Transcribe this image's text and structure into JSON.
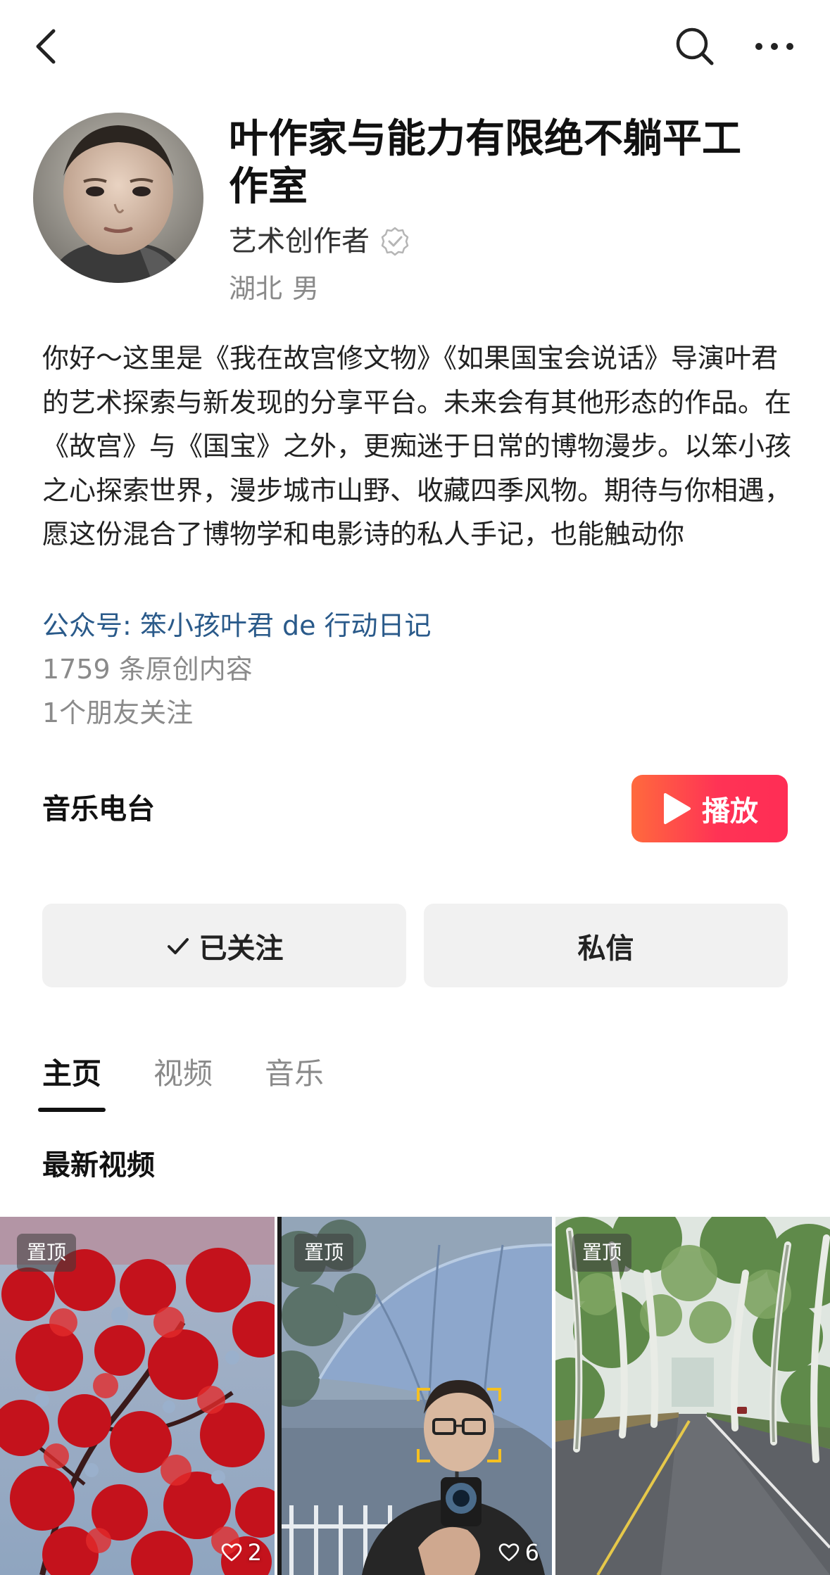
{
  "header": {
    "back_icon": "chevron-left-icon",
    "search_icon": "search-icon",
    "more_icon": "more-dots-icon"
  },
  "profile": {
    "name": "叶作家与能力有限绝不躺平工作室",
    "role": "艺术创作者",
    "verified_icon": "verified-badge-icon",
    "region": "湖北",
    "gender": "男"
  },
  "bio": "你好～这里是《我在故宫修文物》《如果国宝会说话》导演叶君的艺术探索与新发现的分享平台。未来会有其他形态的作品。在《故宫》与《国宝》之外，更痴迷于日常的博物漫步。以笨小孩之心探索世界，漫步城市山野、收藏四季风物。期待与你相遇，愿这份混合了博物学和电影诗的私人手记，也能触动你",
  "official_account": "公众号: 笨小孩叶君 de 行动日记",
  "stats": {
    "original_content": "1759 条原创内容",
    "friends_following": "1个朋友关注"
  },
  "music_radio": {
    "label": "音乐电台",
    "play_label": "播放",
    "accent_start": "#ff6a3d",
    "accent_end": "#ff2d55"
  },
  "actions": {
    "follow_label": "已关注",
    "message_label": "私信"
  },
  "tabs": [
    {
      "label": "主页",
      "active": true
    },
    {
      "label": "视频",
      "active": false
    },
    {
      "label": "音乐",
      "active": false
    }
  ],
  "section": {
    "title": "最新视频"
  },
  "videos": [
    {
      "pin_label": "置顶",
      "likes": "2",
      "thumbnail": "red-maple-leaves"
    },
    {
      "pin_label": "置顶",
      "likes": "6",
      "thumbnail": "man-with-umbrella"
    },
    {
      "pin_label": "置顶",
      "likes": "",
      "thumbnail": "tree-lined-road"
    }
  ]
}
